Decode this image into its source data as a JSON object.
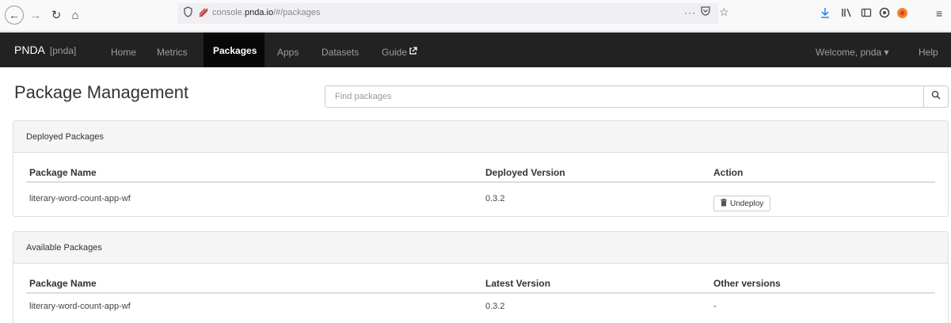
{
  "browser": {
    "url_prefix": "console.",
    "url_domain": "pnda.io",
    "url_path": "/#/packages",
    "more_glyph": "···"
  },
  "navbar": {
    "brand": "PNDA",
    "brand_sub": "[pnda]",
    "items": [
      {
        "label": "Home"
      },
      {
        "label": "Metrics"
      },
      {
        "label": "Packages"
      },
      {
        "label": "Apps"
      },
      {
        "label": "Datasets"
      },
      {
        "label": "Guide"
      }
    ],
    "welcome": "Welcome, pnda ▾",
    "help": "Help"
  },
  "page": {
    "title": "Package Management",
    "search_placeholder": "Find packages"
  },
  "deployed": {
    "heading": "Deployed Packages",
    "columns": [
      "Package Name",
      "Deployed Version",
      "Action"
    ],
    "rows": [
      {
        "name": "literary-word-count-app-wf",
        "version": "0.3.2",
        "action": "Undeploy"
      }
    ]
  },
  "available": {
    "heading": "Available Packages",
    "columns": [
      "Package Name",
      "Latest Version",
      "Other versions"
    ],
    "rows": [
      {
        "name": "literary-word-count-app-wf",
        "version": "0.3.2",
        "other": "-"
      }
    ]
  },
  "colors": {
    "navbar_bg": "#222222",
    "navbar_active_bg": "#080808",
    "panel_heading_bg": "#f5f5f5",
    "border": "#dddddd"
  },
  "icons": {
    "back": "back-arrow-icon",
    "forward": "forward-arrow-icon",
    "reload": "reload-icon",
    "home": "home-icon",
    "search": "search-icon",
    "external_link": "external-link-icon",
    "trash": "trash-icon"
  }
}
